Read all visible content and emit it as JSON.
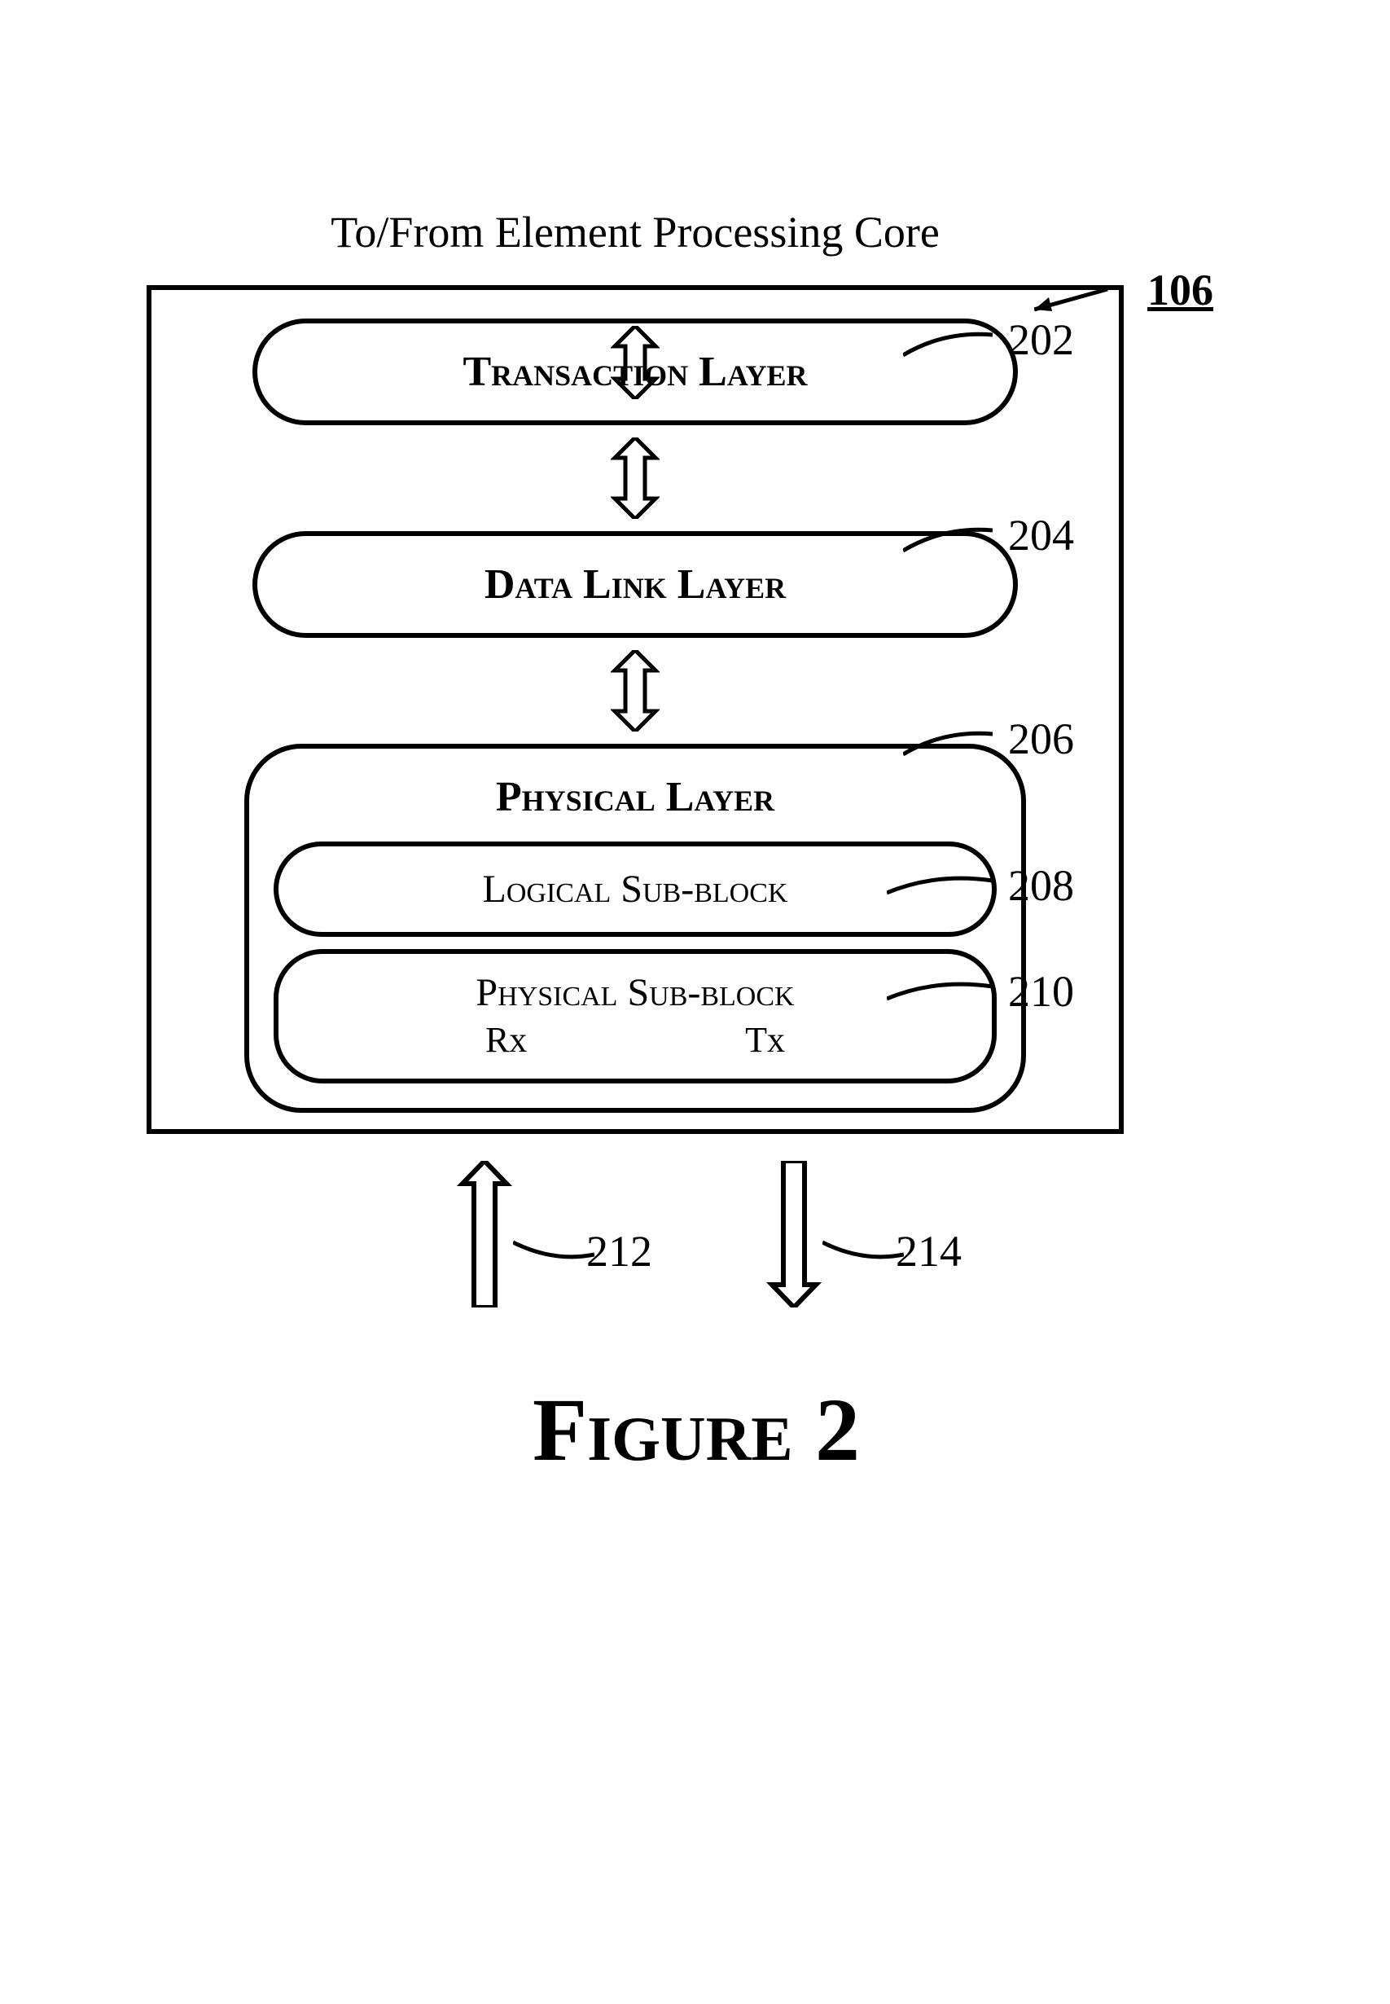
{
  "topLabel": "To/From Element Processing Core",
  "ref106": "106",
  "layers": {
    "transaction": {
      "label": "Transaction Layer",
      "ref": "202"
    },
    "datalink": {
      "label": "Data Link Layer",
      "ref": "204"
    },
    "physical": {
      "label": "Physical Layer",
      "ref": "206",
      "logical": {
        "label": "Logical Sub-block",
        "ref": "208"
      },
      "physicalSub": {
        "label": "Physical Sub-block",
        "ref": "210",
        "rx": "Rx",
        "tx": "Tx"
      }
    }
  },
  "arrows": {
    "rx": "212",
    "tx": "214"
  },
  "figure": "Figure 2"
}
